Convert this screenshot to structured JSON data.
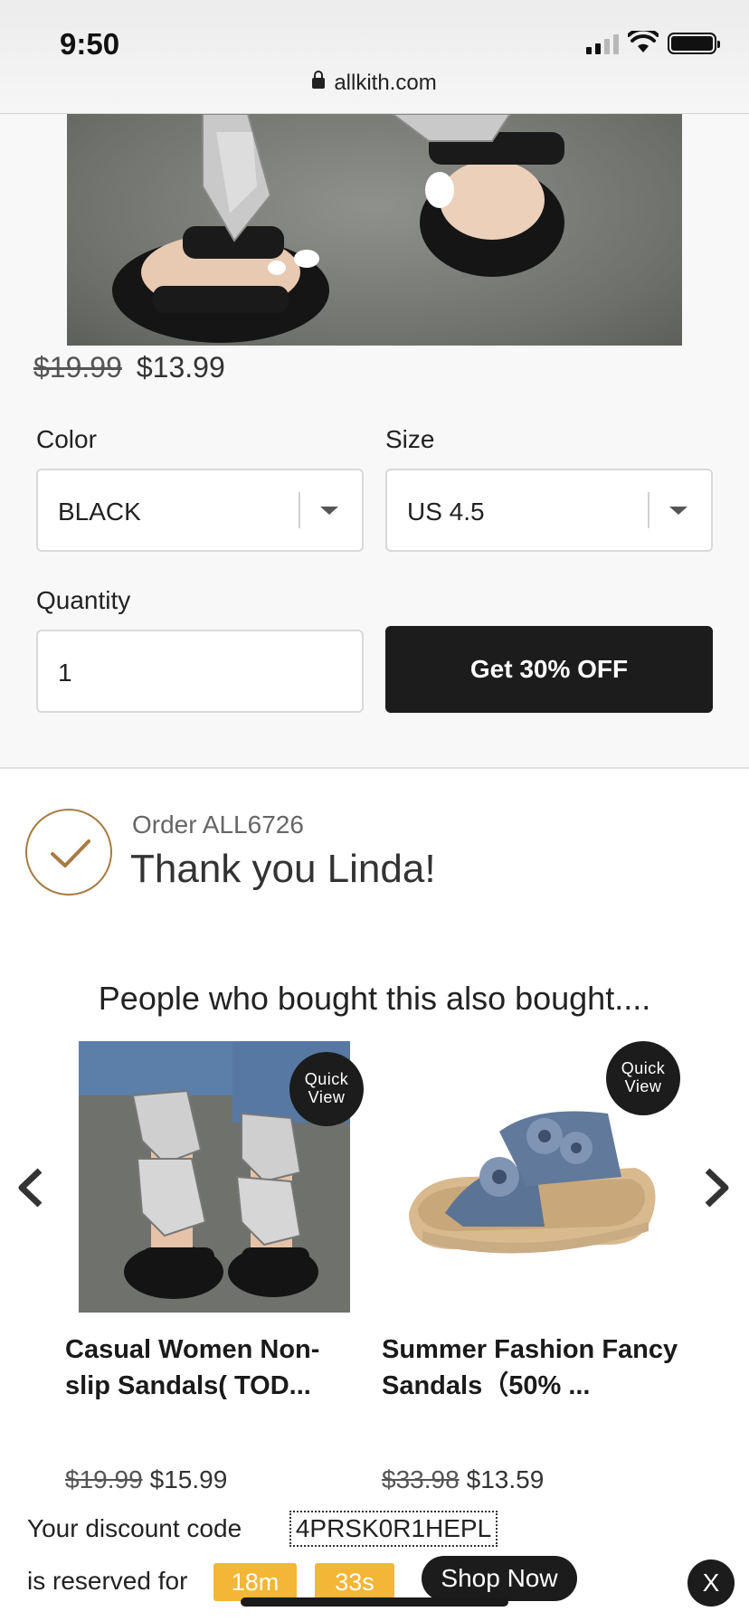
{
  "status_bar": {
    "time": "9:50",
    "url": "allkith.com"
  },
  "product": {
    "price_old": "$19.99",
    "price_new": "$13.99",
    "color_label": "Color",
    "color_value": "BLACK",
    "size_label": "Size",
    "size_value": "US 4.5",
    "quantity_label": "Quantity",
    "quantity_value": "1",
    "cta_label": "Get 30% OFF"
  },
  "order": {
    "number": "Order ALL6726",
    "thanks": "Thank you Linda!"
  },
  "also_bought": {
    "title": "People who bought this also bought....",
    "quick_view_label": "Quick View",
    "items": [
      {
        "name": "Casual Women Non-slip Sandals( TOD...",
        "price_old": "$19.99",
        "price_new": "$15.99"
      },
      {
        "name": "Summer Fashion Fancy Sandals（50% ...",
        "price_old": "$33.98",
        "price_new": "$13.59"
      }
    ]
  },
  "discount": {
    "code_label": "Your discount code",
    "code": "4PRSK0R1HEPL",
    "reserved_label": "is reserved for",
    "minutes": "18m",
    "seconds": "33s",
    "shop_now": "Shop Now",
    "close": "X"
  },
  "colors": {
    "accent_dark": "#1c1c1c",
    "timer_yellow": "#f3b637",
    "check_gold": "#a77b43"
  }
}
